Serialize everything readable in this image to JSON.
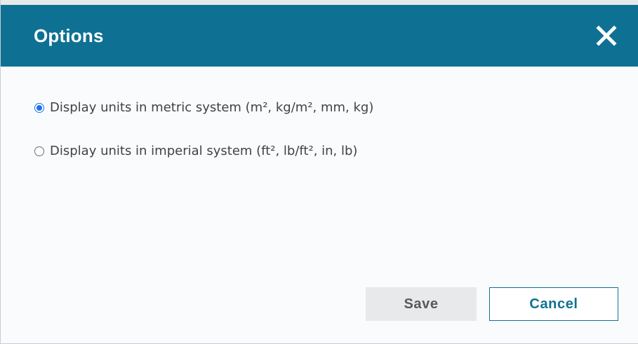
{
  "dialog": {
    "title": "Options",
    "close_icon": "close-icon",
    "header_color": "#0e7193"
  },
  "options": [
    {
      "label": "Display units in metric system (m², kg/m², mm, kg)",
      "selected": true
    },
    {
      "label": "Display units in imperial system (ft², lb/ft², in, lb)",
      "selected": false
    }
  ],
  "buttons": {
    "save_label": "Save",
    "cancel_label": "Cancel"
  }
}
